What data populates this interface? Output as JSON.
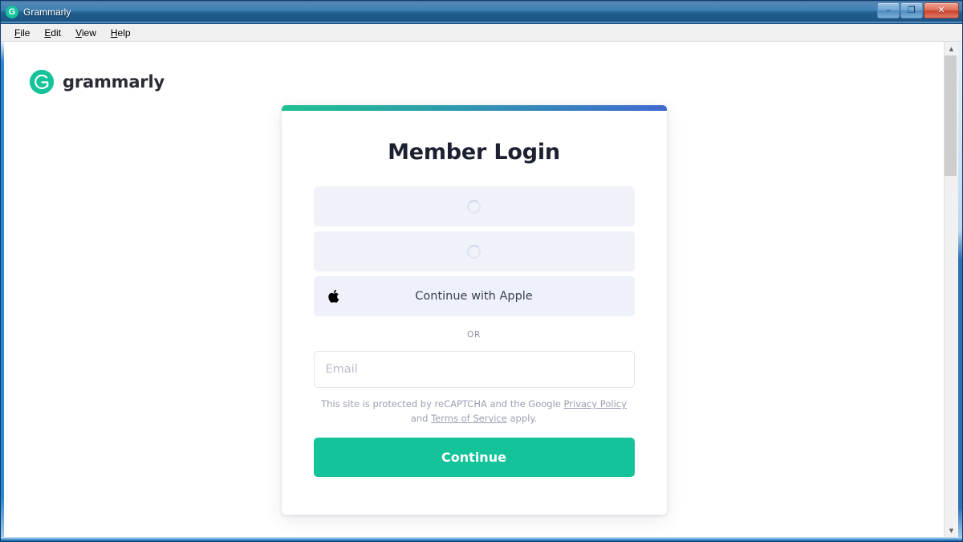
{
  "window": {
    "title": "Grammarly",
    "app_icon": "grammarly-icon",
    "buttons": {
      "minimize": "–",
      "maximize": "❐",
      "close": "✕"
    }
  },
  "menubar": {
    "items": [
      {
        "label": "File",
        "accesskey": "F"
      },
      {
        "label": "Edit",
        "accesskey": "E"
      },
      {
        "label": "View",
        "accesskey": "V"
      },
      {
        "label": "Help",
        "accesskey": "H"
      }
    ]
  },
  "site": {
    "logo_text": "grammarly",
    "logo_icon": "grammarly-circle-logo"
  },
  "card": {
    "accent_gradient_from": "#1fc191",
    "accent_gradient_to": "#4169d0",
    "title": "Member Login",
    "sso_buttons": [
      {
        "id": "google",
        "label": "",
        "state": "loading",
        "icon": "spinner-icon"
      },
      {
        "id": "facebook",
        "label": "",
        "state": "loading",
        "icon": "spinner-icon"
      },
      {
        "id": "apple",
        "label": "Continue with Apple",
        "state": "ready",
        "icon": "apple-icon"
      }
    ],
    "divider_label": "OR",
    "email": {
      "placeholder": "Email",
      "value": ""
    },
    "recaptcha": {
      "text_before": "This site is protected by reCAPTCHA and the Google ",
      "link_privacy": "Privacy Policy",
      "text_middle": " and ",
      "link_terms": "Terms of Service",
      "text_after": " apply."
    },
    "submit_label": "Continue",
    "submit_color": "#15c39a"
  },
  "scrollbar": {
    "up_arrow": "▲",
    "down_arrow": "▼"
  }
}
